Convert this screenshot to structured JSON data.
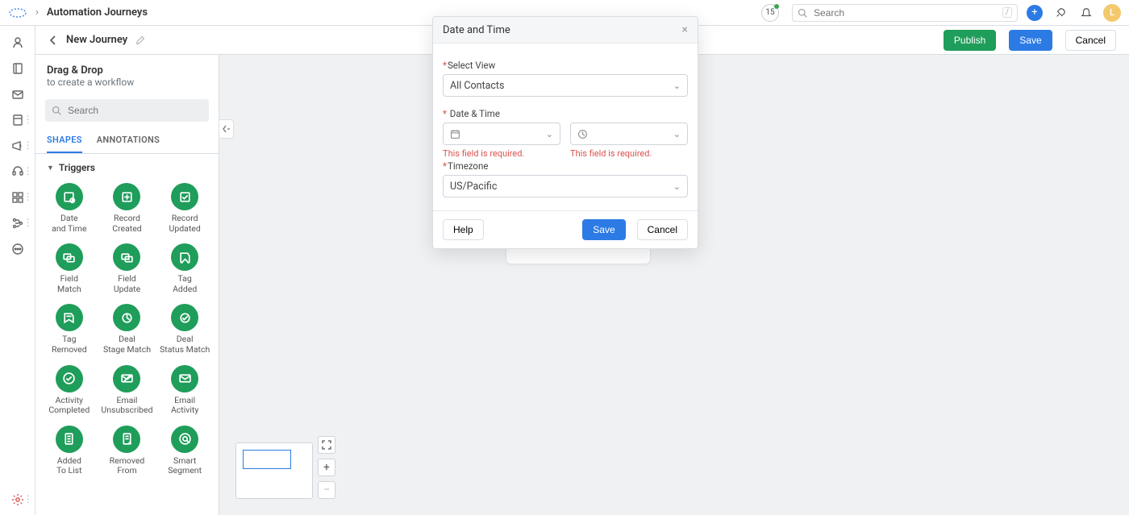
{
  "header": {
    "page_title": "Automation Journeys",
    "badge": "15",
    "search_placeholder": "Search",
    "avatar_initial": "L"
  },
  "subheader": {
    "journey_name": "New Journey",
    "publish": "Publish",
    "save": "Save",
    "cancel": "Cancel"
  },
  "shapes_panel": {
    "title": "Drag & Drop",
    "subtitle": "to create a workflow",
    "search_placeholder": "Search",
    "tab_shapes": "SHAPES",
    "tab_annotations": "ANNOTATIONS",
    "section_triggers": "Triggers",
    "items": [
      {
        "label": "Date and Time"
      },
      {
        "label": "Record Created"
      },
      {
        "label": "Record Updated"
      },
      {
        "label": "Field Match"
      },
      {
        "label": "Field Update"
      },
      {
        "label": "Tag Added"
      },
      {
        "label": "Tag Removed"
      },
      {
        "label": "Deal Stage Match"
      },
      {
        "label": "Deal Status Match"
      },
      {
        "label": "Activity Completed"
      },
      {
        "label": "Email Unsubscribed"
      },
      {
        "label": "Email Activity"
      },
      {
        "label": "Added To List"
      },
      {
        "label": "Removed From"
      },
      {
        "label": "Smart Segment"
      }
    ]
  },
  "zoom": {
    "fit": "⤢",
    "in": "+",
    "out": "−"
  },
  "modal": {
    "title": "Date and Time",
    "select_view_label": "Select View",
    "select_view_value": "All Contacts",
    "datetime_label": " Date & Time",
    "date_value": "",
    "time_value": "",
    "err_date": "This field is required.",
    "err_time": "This field is required.",
    "timezone_label": "Timezone",
    "timezone_value": "US/Pacific",
    "help": "Help",
    "save": "Save",
    "cancel": "Cancel"
  }
}
